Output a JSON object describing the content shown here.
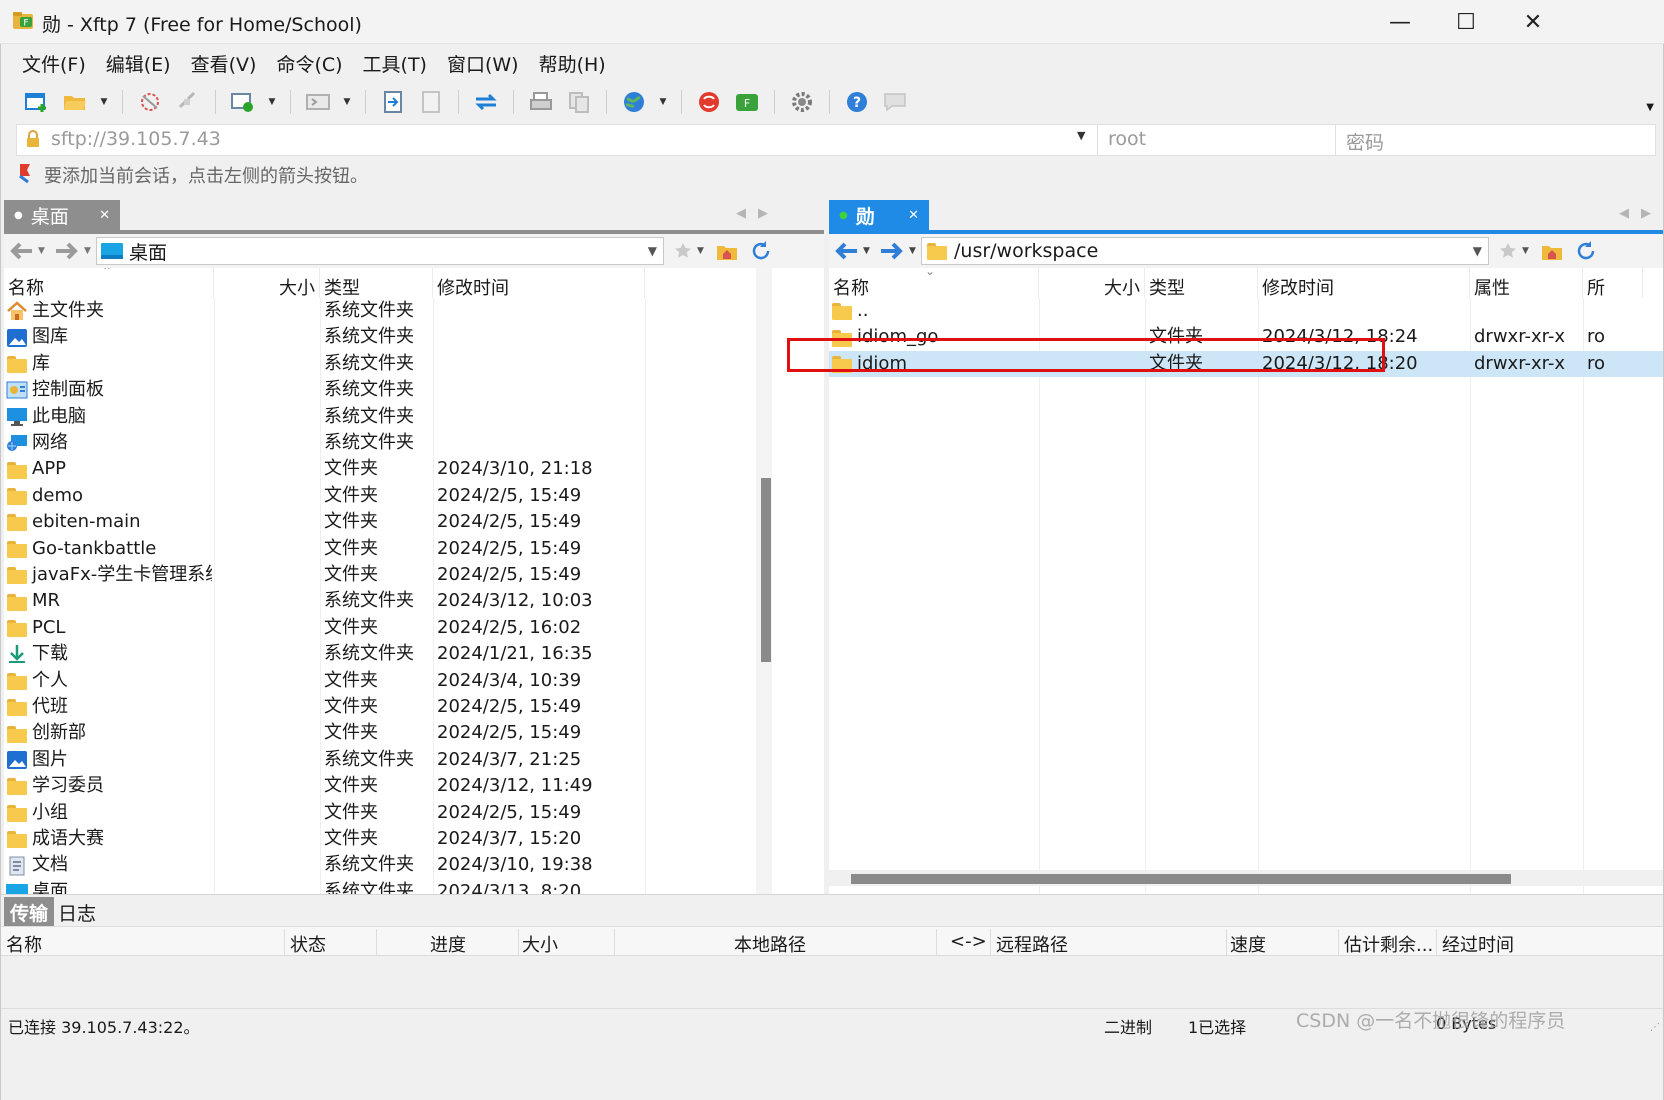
{
  "window": {
    "title": "勋 - Xftp 7 (Free for Home/School)",
    "minimize": "—",
    "maximize": "☐",
    "close": "✕"
  },
  "menu": [
    "文件(F)",
    "编辑(E)",
    "查看(V)",
    "命令(C)",
    "工具(T)",
    "窗口(W)",
    "帮助(H)"
  ],
  "toolbar": {
    "icons": [
      "new-session-icon",
      "open-folder-icon",
      "disconnect-icon",
      "reconnect-icon",
      "new-window-icon",
      "terminal-icon",
      "upload-icon",
      "download-icon",
      "sync-icon",
      "print-icon",
      "copy-icon",
      "globe-icon",
      "xshell-icon",
      "xftp-icon",
      "settings-icon",
      "help-icon",
      "comment-icon"
    ]
  },
  "address": {
    "url": "sftp://39.105.7.43",
    "username": "root",
    "password": "密码"
  },
  "hint": "要添加当前会话，点击左侧的箭头按钮。",
  "left": {
    "tab_label": "桌面",
    "path": "桌面",
    "columns": [
      "名称",
      "大小",
      "类型",
      "修改时间"
    ],
    "rows": [
      {
        "icon": "home",
        "name": "主文件夹",
        "type": "系统文件夹",
        "modified": ""
      },
      {
        "icon": "gallery",
        "name": "图库",
        "type": "系统文件夹",
        "modified": ""
      },
      {
        "icon": "folder",
        "name": "库",
        "type": "系统文件夹",
        "modified": ""
      },
      {
        "icon": "control-panel",
        "name": "控制面板",
        "type": "系统文件夹",
        "modified": ""
      },
      {
        "icon": "computer",
        "name": "此电脑",
        "type": "系统文件夹",
        "modified": ""
      },
      {
        "icon": "network",
        "name": "网络",
        "type": "系统文件夹",
        "modified": ""
      },
      {
        "icon": "folder",
        "name": "APP",
        "type": "文件夹",
        "modified": "2024/3/10, 21:18"
      },
      {
        "icon": "folder",
        "name": "demo",
        "type": "文件夹",
        "modified": "2024/2/5, 15:49"
      },
      {
        "icon": "folder",
        "name": "ebiten-main",
        "type": "文件夹",
        "modified": "2024/2/5, 15:49"
      },
      {
        "icon": "folder",
        "name": "Go-tankbattle",
        "type": "文件夹",
        "modified": "2024/2/5, 15:49"
      },
      {
        "icon": "folder",
        "name": "javaFx-学生卡管理系统",
        "type": "文件夹",
        "modified": "2024/2/5, 15:49"
      },
      {
        "icon": "folder",
        "name": "MR",
        "type": "系统文件夹",
        "modified": "2024/3/12, 10:03"
      },
      {
        "icon": "folder",
        "name": "PCL",
        "type": "文件夹",
        "modified": "2024/2/5, 16:02"
      },
      {
        "icon": "download",
        "name": "下载",
        "type": "系统文件夹",
        "modified": "2024/1/21, 16:35"
      },
      {
        "icon": "folder",
        "name": "个人",
        "type": "文件夹",
        "modified": "2024/3/4, 10:39"
      },
      {
        "icon": "folder",
        "name": "代班",
        "type": "文件夹",
        "modified": "2024/2/5, 15:49"
      },
      {
        "icon": "folder",
        "name": "创新部",
        "type": "文件夹",
        "modified": "2024/2/5, 15:49"
      },
      {
        "icon": "pictures",
        "name": "图片",
        "type": "系统文件夹",
        "modified": "2024/3/7, 21:25"
      },
      {
        "icon": "folder",
        "name": "学习委员",
        "type": "文件夹",
        "modified": "2024/3/12, 11:49"
      },
      {
        "icon": "folder",
        "name": "小组",
        "type": "文件夹",
        "modified": "2024/2/5, 15:49"
      },
      {
        "icon": "folder",
        "name": "成语大赛",
        "type": "文件夹",
        "modified": "2024/3/7, 15:20"
      },
      {
        "icon": "document",
        "name": "文档",
        "type": "系统文件夹",
        "modified": "2024/3/10, 19:38"
      },
      {
        "icon": "desktop",
        "name": "桌面",
        "type": "系统文件夹",
        "modified": "2024/3/13, 8:20"
      }
    ]
  },
  "right": {
    "tab_label": "勋",
    "path": "/usr/workspace",
    "columns": [
      "名称",
      "大小",
      "类型",
      "修改时间",
      "属性",
      "所"
    ],
    "rows": [
      {
        "name": "..",
        "type": "",
        "modified": "",
        "attrs": "",
        "owner": ""
      },
      {
        "name": "idiom_go",
        "type": "文件夹",
        "modified": "2024/3/12, 18:24",
        "attrs": "drwxr-xr-x",
        "owner": "ro"
      },
      {
        "name": "idiom",
        "type": "文件夹",
        "modified": "2024/3/12, 18:20",
        "attrs": "drwxr-xr-x",
        "owner": "ro"
      }
    ],
    "selected_index": 2
  },
  "transfer": {
    "tabs": [
      "传输",
      "日志"
    ],
    "columns": [
      "名称",
      "状态",
      "进度",
      "大小",
      "本地路径",
      "<->",
      "远程路径",
      "速度",
      "估计剩余...",
      "经过时间"
    ]
  },
  "status": {
    "connection": "已连接 39.105.7.43:22。",
    "mode": "二进制",
    "selection": "1已选择",
    "size": "0 Bytes"
  },
  "watermark": "CSDN @一名不抛很锋的程序员",
  "colors": {
    "accent": "#1f8be6",
    "selection": "#cde6f7",
    "highlight_box": "#e01010",
    "folder": "#f7c94c"
  }
}
